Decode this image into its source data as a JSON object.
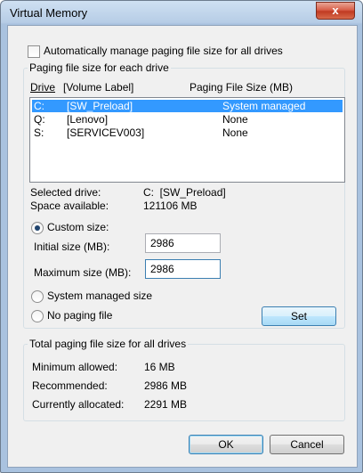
{
  "window": {
    "title": "Virtual Memory",
    "close_glyph": "x"
  },
  "auto_manage": {
    "label": "Automatically manage paging file size for all drives",
    "checked": false
  },
  "drive_group": {
    "legend": "Paging file size for each drive",
    "col_drive": "Drive",
    "col_volume": "[Volume Label]",
    "col_paging": "Paging File Size (MB)",
    "rows": [
      {
        "drive": "C:",
        "label": "[SW_Preload]",
        "size": "System managed",
        "selected": true
      },
      {
        "drive": "Q:",
        "label": "[Lenovo]",
        "size": "None",
        "selected": false
      },
      {
        "drive": "S:",
        "label": "[SERVICEV003]",
        "size": "None",
        "selected": false
      }
    ],
    "selected_drive_label": "Selected drive:",
    "selected_drive_value": "C:  [SW_Preload]",
    "space_label": "Space available:",
    "space_value": "121106 MB",
    "custom_size_label": "Custom size:",
    "initial_label": "Initial size (MB):",
    "initial_value": "2986",
    "maximum_label": "Maximum size (MB):",
    "maximum_value": "2986",
    "system_managed_label": "System managed size",
    "no_paging_label": "No paging file",
    "set_button": "Set",
    "selected_option": "custom"
  },
  "totals_group": {
    "legend": "Total paging file size for all drives",
    "min_label": "Minimum allowed:",
    "min_value": "16 MB",
    "rec_label": "Recommended:",
    "rec_value": "2986 MB",
    "cur_label": "Currently allocated:",
    "cur_value": "2291 MB"
  },
  "footer": {
    "ok_label": "OK",
    "cancel_label": "Cancel"
  },
  "colors": {
    "selection": "#3399ff",
    "titlebar": "#b7cde6",
    "close": "#c13a22"
  },
  "icons": {
    "close": "close-icon"
  }
}
